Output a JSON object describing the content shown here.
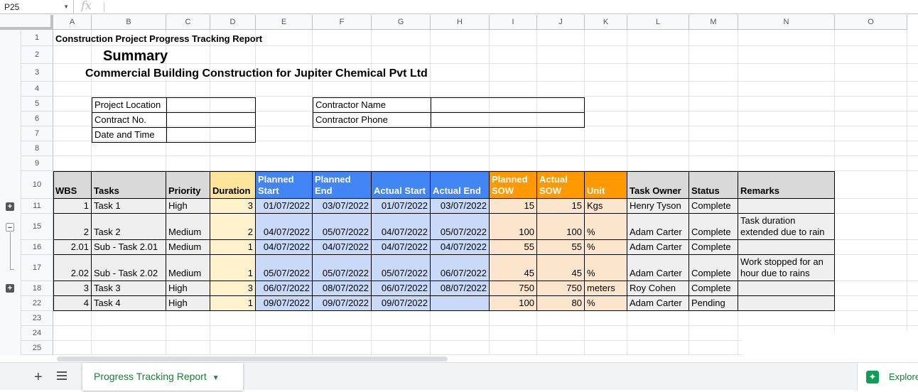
{
  "formula_bar": {
    "cell_ref": "P25",
    "fx": "fx",
    "value": ""
  },
  "columns": [
    "A",
    "B",
    "C",
    "D",
    "E",
    "F",
    "G",
    "H",
    "I",
    "J",
    "K",
    "L",
    "M",
    "N",
    "O"
  ],
  "rows": [
    "1",
    "2",
    "3",
    "4",
    "5",
    "6",
    "7",
    "8",
    "9",
    "10",
    "11",
    "15",
    "16",
    "17",
    "18",
    "22",
    "23",
    "24",
    "25"
  ],
  "titles": {
    "report": "Construction Project Progress Tracking Report",
    "summary": "Summary",
    "project": "Commercial Building Construction for Jupiter Chemical Pvt Ltd"
  },
  "info": {
    "project_location": "Project Location",
    "contract_no": "Contract No.",
    "date_time": "Date and Time",
    "contractor_name": "Contractor Name",
    "contractor_phone": "Contractor Phone"
  },
  "table_headers": {
    "wbs": "WBS",
    "tasks": "Tasks",
    "priority": "Priority",
    "duration": "Duration",
    "planned_start": "Planned Start",
    "planned_end": "Planned End",
    "actual_start": "Actual Start",
    "actual_end": "Actual End",
    "planned_sow": "Planned SOW",
    "actual_sow": "Actual SOW",
    "unit": "Unit",
    "task_owner": "Task Owner",
    "status": "Status",
    "remarks": "Remarks"
  },
  "table_rows": [
    {
      "wbs": "1",
      "task": "Task 1",
      "priority": "High",
      "duration": "3",
      "ps": "01/07/2022",
      "pe": "03/07/2022",
      "as": "01/07/2022",
      "ae": "03/07/2022",
      "psow": "15",
      "asow": "15",
      "unit": "Kgs",
      "owner": "Henry Tyson",
      "status": "Complete",
      "remarks": ""
    },
    {
      "wbs": "2",
      "task": "Task 2",
      "priority": "Medium",
      "duration": "2",
      "ps": "04/07/2022",
      "pe": "05/07/2022",
      "as": "04/07/2022",
      "ae": "05/07/2022",
      "psow": "100",
      "asow": "100",
      "unit": "%",
      "owner": "Adam Carter",
      "status": "Complete",
      "remarks": "Task duration extended due to rain"
    },
    {
      "wbs": "2.01",
      "task": " Sub - Task 2.01",
      "priority": "Medium",
      "duration": "1",
      "ps": "04/07/2022",
      "pe": "04/07/2022",
      "as": "04/07/2022",
      "ae": "04/07/2022",
      "psow": "55",
      "asow": "55",
      "unit": "%",
      "owner": "Adam Carter",
      "status": "Complete",
      "remarks": ""
    },
    {
      "wbs": "2.02",
      "task": " Sub - Task 2.02",
      "priority": "Medium",
      "duration": "1",
      "ps": "05/07/2022",
      "pe": "05/07/2022",
      "as": "05/07/2022",
      "ae": "06/07/2022",
      "psow": "45",
      "asow": "45",
      "unit": "%",
      "owner": "Adam Carter",
      "status": "Complete",
      "remarks": "Work stopped for an hour due to rains"
    },
    {
      "wbs": "3",
      "task": "Task 3",
      "priority": "High",
      "duration": "3",
      "ps": "06/07/2022",
      "pe": "08/07/2022",
      "as": "06/07/2022",
      "ae": "08/07/2022",
      "psow": "750",
      "asow": "750",
      "unit": "meters",
      "owner": "Roy Cohen",
      "status": "Complete",
      "remarks": ""
    },
    {
      "wbs": "4",
      "task": "Task 4",
      "priority": "High",
      "duration": "1",
      "ps": "09/07/2022",
      "pe": "09/07/2022",
      "as": "09/07/2022",
      "ae": "",
      "psow": "100",
      "asow": "80",
      "unit": "%",
      "owner": "Adam Carter",
      "status": "Pending",
      "remarks": ""
    }
  ],
  "colors": {
    "gray_header": "#d9d9d9",
    "yellow_header": "#ffe599",
    "yellow_body": "#fff2cc",
    "blue_header": "#4285f4",
    "blue_body": "#c9daf8",
    "orange_header": "#ff9900",
    "orange_body": "#fce5cd",
    "gray_body": "#efefef"
  },
  "sheet_tab": {
    "name": "Progress Tracking Report",
    "caret": "▼"
  },
  "bottom": {
    "add": "+",
    "explore": "Explore"
  }
}
